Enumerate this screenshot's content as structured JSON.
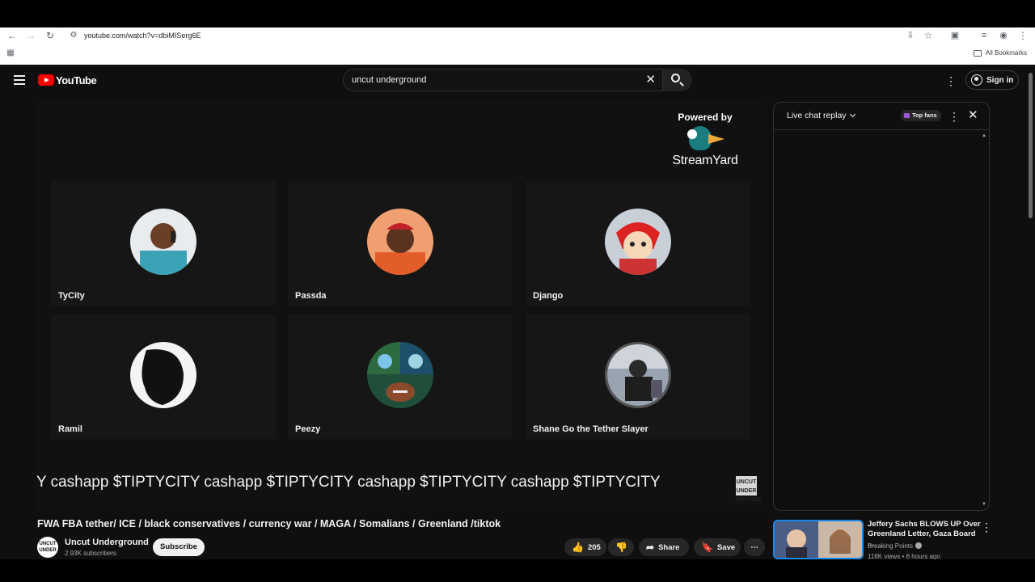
{
  "browser": {
    "url": "youtube.com/watch?v=dbiMISerg6E",
    "bookmarks_label": "All Bookmarks"
  },
  "masthead": {
    "logo_text": "YouTube",
    "search_value": "uncut underground",
    "signin_label": "Sign in"
  },
  "player": {
    "powered_by": "Powered by",
    "brand": "StreamYard",
    "participants": [
      {
        "name": "TyCity",
        "avatar": "man-on-phone"
      },
      {
        "name": "Passda",
        "avatar": "man-red-cap"
      },
      {
        "name": "Django",
        "avatar": "anime-character"
      },
      {
        "name": "Ramil",
        "avatar": "silhouette"
      },
      {
        "name": "Peezy",
        "avatar": "football-matchup"
      },
      {
        "name": "Shane Go the Tether Slayer",
        "avatar": "person-in-car"
      }
    ],
    "ticker": "Y cashapp $TIPTYCITY cashapp $TIPTYCITY cashapp $TIPTYCITY cashapp $TIPTYCITY",
    "watermark": "UNCUT UNDER GROUND"
  },
  "video": {
    "title": "FWA FBA tether/ ICE / black conservatives / currency war / MAGA / Somalians / Greenland /tiktok",
    "channel_name": "Uncut Underground",
    "subscribers": "2.93K subscribers",
    "subscribe_label": "Subscribe",
    "likes": "205",
    "share_label": "Share",
    "save_label": "Save"
  },
  "chat": {
    "title": "Live chat replay",
    "top_fans_label": "Top fans"
  },
  "recommendation": {
    "title": "Jeffery Sachs BLOWS UP Over Greenland Letter, Gaza Board ...",
    "channel": "Breaking Points",
    "stats": "118K views • 6 hours ago"
  },
  "colors": {
    "background": "#0f0f0f",
    "youtube_red": "#ff0000",
    "chip": "#272727"
  }
}
